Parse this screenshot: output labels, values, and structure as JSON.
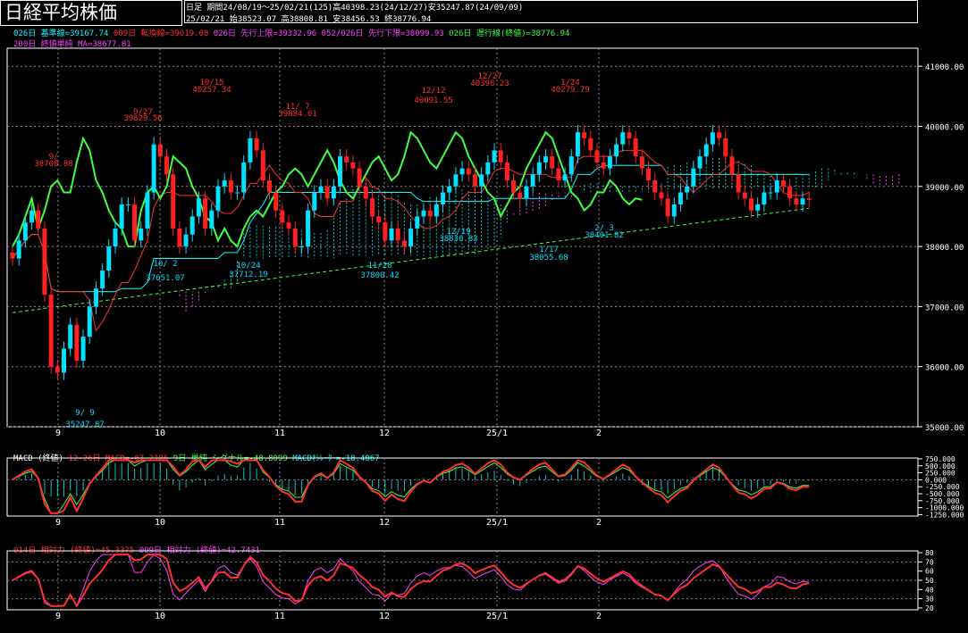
{
  "header": {
    "title": "日経平均株価",
    "line1": "日足  期間24/08/19～25/02/21(125)高40398.23(24/12/27)安35247.87(24/09/09)",
    "line2": "25/02/21      始38523.07 高38808.81 安38456.53 終38776.94"
  },
  "legend": {
    "row1": [
      {
        "text": "026日 基準線=39167.74",
        "color": "#00ffff"
      },
      {
        "text": "009日 転換線=39019.08",
        "color": "#ff3030"
      },
      {
        "text": "026日 先行上限=39332.96",
        "color": "#ff40ff"
      },
      {
        "text": "052/026日 先行下限=38099.93",
        "color": "#ff40ff"
      },
      {
        "text": "026日 遅行線(終値)=38776.94",
        "color": "#40ff40"
      }
    ],
    "row2": [
      {
        "text": "200日 終値単純 MA=38677.81",
        "color": "#ff40ff"
      }
    ],
    "macd": [
      {
        "text": "MACD (終値)",
        "color": "#ffffff"
      },
      {
        "text": "12-26日 MACD=-67.2186",
        "color": "#ff3030"
      },
      {
        "text": "9日 単純 シグナル=-48.8099",
        "color": "#40ff40"
      },
      {
        "text": "MACDｵｼﾚｰﾀｰ=-18.4067",
        "color": "#00ffff"
      }
    ],
    "rsi": [
      {
        "text": "014日 相対力 (終値)=45.3375",
        "color": "#ff3030"
      },
      {
        "text": "009日 相対力 (終値)=42.7431",
        "color": "#ff40ff"
      }
    ]
  },
  "chart_data": [
    {
      "type": "candlestick",
      "title": "日経平均株価",
      "x_ticks": [
        "9",
        "10",
        "11",
        "12",
        "25/1",
        "2"
      ],
      "y_ticks": [
        "35000.00",
        "36000.00",
        "37000.00",
        "38000.00",
        "39000.00",
        "40000.00",
        "41000.00"
      ],
      "ylim": [
        35000,
        41300
      ],
      "annotations": [
        {
          "date": "9/9",
          "text": "35247.87",
          "label": "9/ 9"
        },
        {
          "date": "9/27",
          "text": "39829.56",
          "label": "9/27"
        },
        {
          "date": "10/2",
          "text": "37651.07",
          "label": "10/ 2"
        },
        {
          "date": "10/15",
          "text": "40257.34",
          "label": "10/15"
        },
        {
          "date": "10/24",
          "text": "37712.19",
          "label": "10/24"
        },
        {
          "date": "11/7",
          "text": "39884.01",
          "label": "11/ 7"
        },
        {
          "date": "11/28",
          "text": "37800.42",
          "label": "11/28"
        },
        {
          "date": "12/12",
          "text": "40091.55",
          "label": "12/12"
        },
        {
          "date": "12/19",
          "text": "38836.83",
          "label": "12/19"
        },
        {
          "date": "12/27",
          "text": "40398.23",
          "label": "12/27"
        },
        {
          "date": "1/17",
          "text": "38055.68",
          "label": "1/17"
        },
        {
          "date": "1/24",
          "text": "40279.79",
          "label": "1/24"
        },
        {
          "date": "2/3",
          "text": "38401.82",
          "label": "2/ 3"
        },
        {
          "date": "9/2",
          "text": "38700.88",
          "label": "9/"
        }
      ],
      "closes": [
        37800,
        38100,
        38400,
        38600,
        38300,
        37200,
        36000,
        35900,
        36300,
        36700,
        36100,
        36500,
        37000,
        37300,
        37600,
        38000,
        38300,
        38700,
        38700,
        38100,
        38300,
        38900,
        39700,
        39500,
        39200,
        38300,
        38000,
        38200,
        38500,
        38800,
        38300,
        38600,
        39000,
        39100,
        38900,
        38900,
        39400,
        39800,
        39600,
        39100,
        38900,
        38600,
        38400,
        38300,
        38000,
        38000,
        38600,
        38900,
        39000,
        38800,
        39000,
        39500,
        39400,
        39300,
        39000,
        38800,
        38500,
        38400,
        38100,
        38300,
        38100,
        38000,
        38300,
        38500,
        38600,
        38500,
        38700,
        38900,
        39000,
        39200,
        39300,
        39200,
        39000,
        39200,
        39400,
        39600,
        39400,
        39100,
        38900,
        38800,
        39000,
        39200,
        39400,
        39500,
        39300,
        39100,
        39200,
        39500,
        39900,
        39800,
        39600,
        39400,
        39300,
        39500,
        39700,
        39900,
        39800,
        39500,
        39300,
        39100,
        38900,
        38800,
        38500,
        38700,
        38900,
        39000,
        39300,
        39500,
        39700,
        39900,
        39800,
        39500,
        39200,
        38900,
        38800,
        38600,
        38700,
        38900,
        38900,
        39100,
        39000,
        38800,
        38700,
        38800,
        38776.94
      ],
      "series": [
        {
          "name": "026日 基準線",
          "color": "#00ffff"
        },
        {
          "name": "009日 転換線",
          "color": "#ff3030"
        },
        {
          "name": "026日 遅行線(終値)",
          "color": "#40ff40"
        },
        {
          "name": "200日 終値単純 MA",
          "color": "#40ff40"
        }
      ]
    },
    {
      "type": "line",
      "title": "MACD (終値)",
      "x_ticks": [
        "9",
        "10",
        "11",
        "12",
        "25/1",
        "2"
      ],
      "y_ticks": [
        "750.000",
        "500.000",
        "250.000",
        "0.000",
        "-250.000",
        "-500.000",
        "-750.000",
        "-1000.000",
        "-1250.000"
      ],
      "ylim": [
        -1300,
        780
      ],
      "series": [
        {
          "name": "12-26日 MACD",
          "color": "#ff3030"
        },
        {
          "name": "9日 単純 シグナル",
          "color": "#40ff40"
        },
        {
          "name": "MACDｵｼﾚｰﾀｰ",
          "color": "#00ffff"
        }
      ]
    },
    {
      "type": "line",
      "title": "相対力",
      "x_ticks": [
        "9",
        "10",
        "11",
        "12",
        "25/1",
        "2"
      ],
      "y_ticks": [
        "80",
        "70",
        "60",
        "50",
        "40",
        "30",
        "20"
      ],
      "ylim": [
        18,
        82
      ],
      "series": [
        {
          "name": "014日 相対力 (終値)",
          "color": "#ff3030"
        },
        {
          "name": "009日 相対力 (終値)",
          "color": "#ff40ff"
        }
      ]
    }
  ]
}
